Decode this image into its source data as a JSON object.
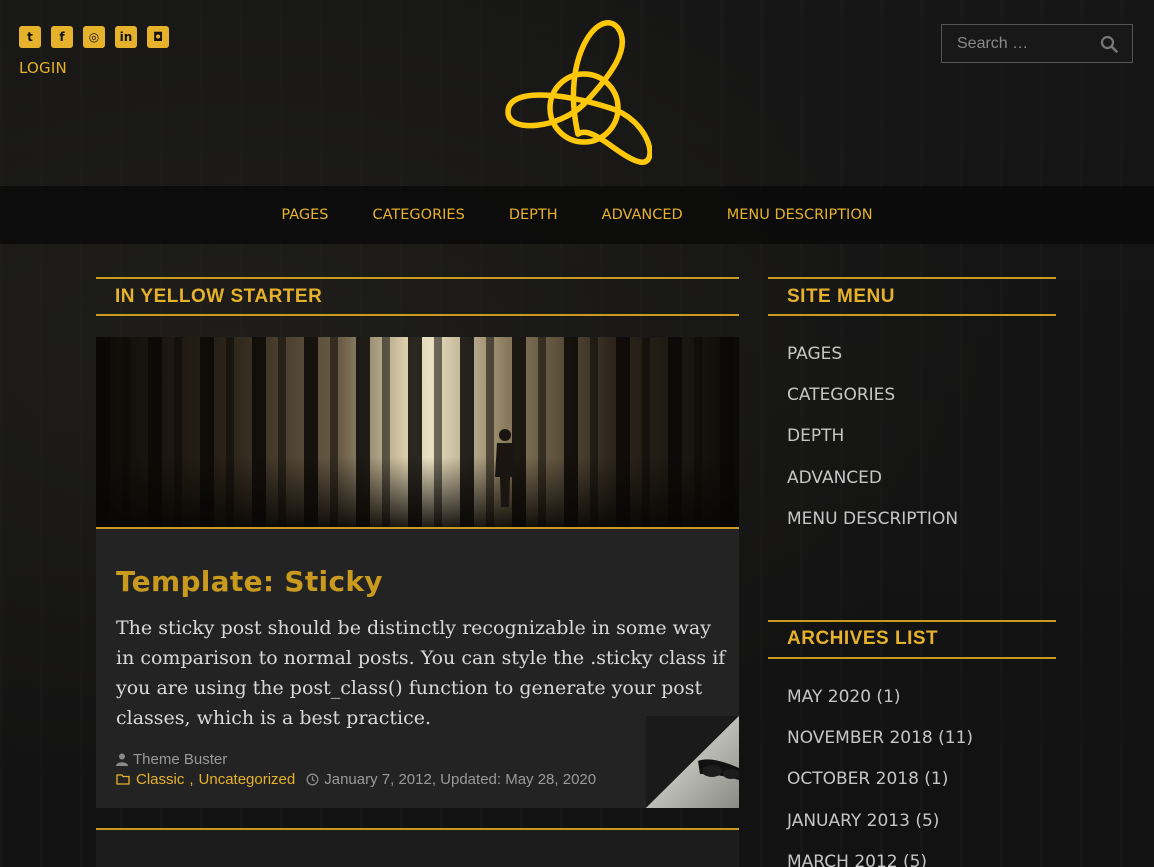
{
  "header": {
    "social": [
      {
        "name": "twitter",
        "glyph": "t"
      },
      {
        "name": "facebook",
        "glyph": "f"
      },
      {
        "name": "github",
        "glyph": "◎"
      },
      {
        "name": "linkedin",
        "glyph": "in"
      },
      {
        "name": "instagram",
        "glyph": "◘"
      }
    ],
    "login_label": "LOGIN",
    "search_placeholder": "Search …"
  },
  "nav": {
    "items": [
      "PAGES",
      "CATEGORIES",
      "DEPTH",
      "ADVANCED",
      "MENU DESCRIPTION"
    ]
  },
  "main": {
    "section_title": "IN YELLOW STARTER",
    "post": {
      "title": "Template: Sticky",
      "excerpt": "The sticky post should be distinctly recognizable in some way in comparison to normal posts. You can style the .sticky class if you are using the post_class() function to generate your post classes, which is a best practice.",
      "author": "Theme Buster",
      "categories": [
        "Classic",
        "Uncategorized"
      ],
      "date": "January 7, 2012, Updated: May 28, 2020"
    }
  },
  "sidebar": {
    "site_menu_title": "SITE MENU",
    "site_menu": [
      "PAGES",
      "CATEGORIES",
      "DEPTH",
      "ADVANCED",
      "MENU DESCRIPTION"
    ],
    "archives_title": "ARCHIVES LIST",
    "archives": [
      "MAY 2020 (1)",
      "NOVEMBER 2018 (11)",
      "OCTOBER 2018 (1)",
      "JANUARY 2013 (5)",
      "MARCH 2012 (5)"
    ]
  },
  "colors": {
    "accent": "#e6b12b",
    "background": "#141414",
    "card": "#232323"
  }
}
